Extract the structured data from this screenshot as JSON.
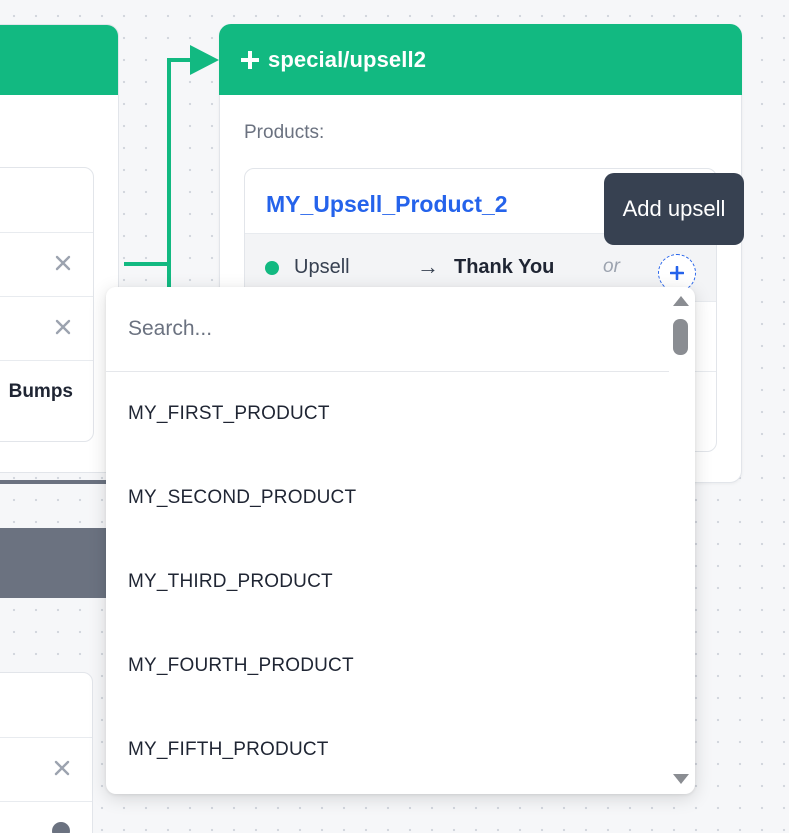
{
  "colors": {
    "accent_green": "#12b981",
    "link_blue": "#2563eb",
    "tooltip_bg": "#374151",
    "muted_gray": "#6b7280"
  },
  "left_card": {
    "bumps_label": "Bumps",
    "row_icons": [
      "close-icon",
      "close-icon"
    ],
    "lower_row_icons": [
      "close-icon",
      "info-icon"
    ]
  },
  "node": {
    "icon": "plus-icon",
    "title": "special/upsell2",
    "products_label": "Products:",
    "product": {
      "name": "MY_Upsell_Product_2",
      "status_label": "Upsell",
      "arrow": "→",
      "target_label": "Thank You",
      "or_label": "or"
    }
  },
  "tooltip": {
    "text": "Add upsell"
  },
  "dropdown": {
    "search_placeholder": "Search...",
    "options": [
      "MY_FIRST_PRODUCT",
      "MY_SECOND_PRODUCT",
      "MY_THIRD_PRODUCT",
      "MY_FOURTH_PRODUCT",
      "MY_FIFTH_PRODUCT"
    ]
  }
}
